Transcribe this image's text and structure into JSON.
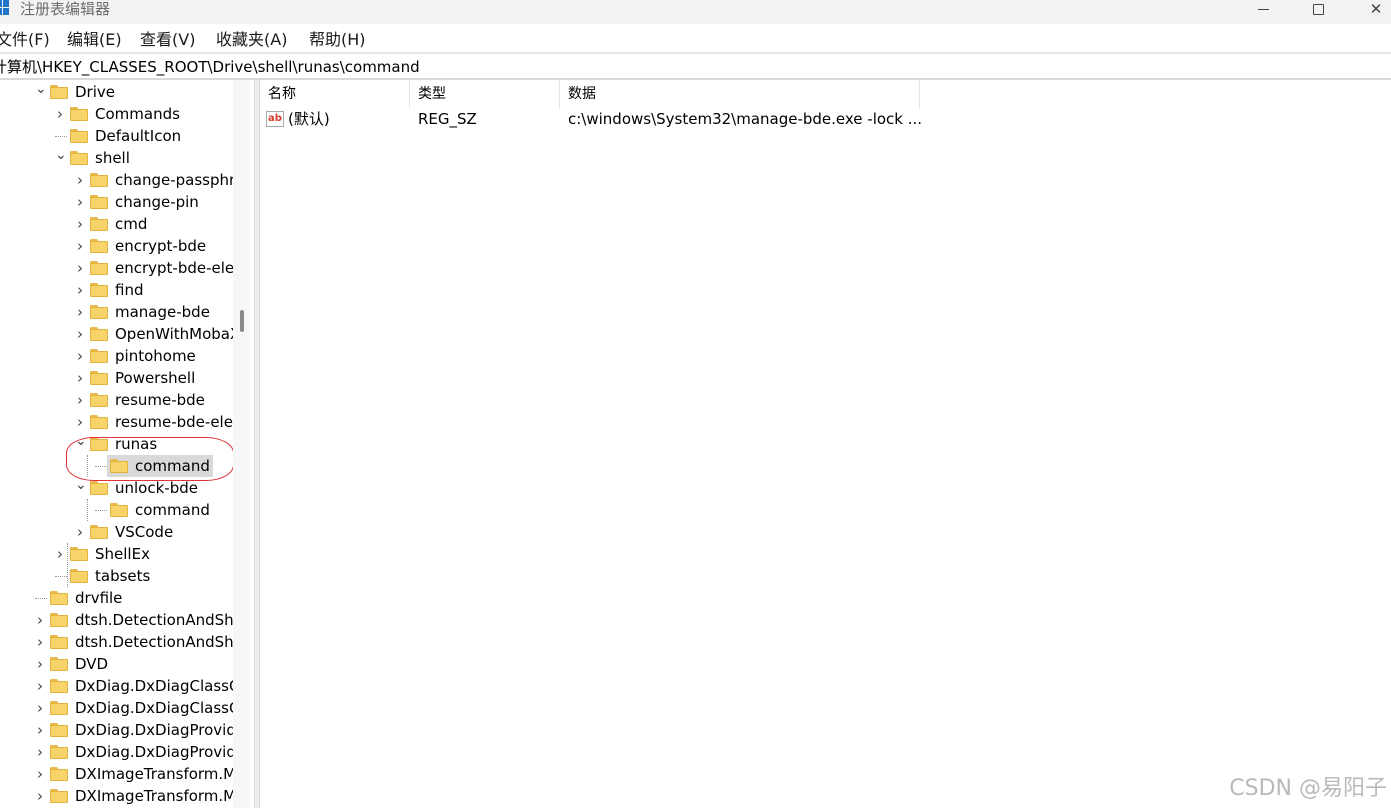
{
  "window": {
    "title": "注册表编辑器",
    "controls": [
      "minimize-icon",
      "maximize-icon",
      "close-icon"
    ]
  },
  "menu": [
    "文件(F)",
    "编辑(E)",
    "查看(V)",
    "收藏夹(A)",
    "帮助(H)"
  ],
  "address": "计算机\\HKEY_CLASSES_ROOT\\Drive\\shell\\runas\\command",
  "tree": {
    "items": [
      {
        "label": "Drive",
        "expand": "expanded"
      },
      {
        "label": "Commands",
        "expand": "collapsed"
      },
      {
        "label": "DefaultIcon",
        "expand": "none"
      },
      {
        "label": "shell",
        "expand": "expanded"
      },
      {
        "label": "change-passphrase",
        "expand": "collapsed"
      },
      {
        "label": "change-pin",
        "expand": "collapsed"
      },
      {
        "label": "cmd",
        "expand": "collapsed"
      },
      {
        "label": "encrypt-bde",
        "expand": "collapsed"
      },
      {
        "label": "encrypt-bde-elev",
        "expand": "collapsed"
      },
      {
        "label": "find",
        "expand": "collapsed"
      },
      {
        "label": "manage-bde",
        "expand": "collapsed"
      },
      {
        "label": "OpenWithMobaXterm",
        "expand": "collapsed"
      },
      {
        "label": "pintohome",
        "expand": "collapsed"
      },
      {
        "label": "Powershell",
        "expand": "collapsed"
      },
      {
        "label": "resume-bde",
        "expand": "collapsed"
      },
      {
        "label": "resume-bde-elev",
        "expand": "collapsed"
      },
      {
        "label": "runas",
        "expand": "expanded"
      },
      {
        "label": "command",
        "expand": "none",
        "selected": true
      },
      {
        "label": "unlock-bde",
        "expand": "expanded"
      },
      {
        "label": "command",
        "expand": "none"
      },
      {
        "label": "VSCode",
        "expand": "collapsed"
      },
      {
        "label": "ShellEx",
        "expand": "collapsed"
      },
      {
        "label": "tabsets",
        "expand": "none"
      },
      {
        "label": "drvfile",
        "expand": "none"
      },
      {
        "label": "dtsh.DetectionAndSharing",
        "expand": "collapsed"
      },
      {
        "label": "dtsh.DetectionAndSharing",
        "expand": "collapsed"
      },
      {
        "label": "DVD",
        "expand": "collapsed"
      },
      {
        "label": "DxDiag.DxDiagClassObject",
        "expand": "collapsed"
      },
      {
        "label": "DxDiag.DxDiagClassObject",
        "expand": "collapsed"
      },
      {
        "label": "DxDiag.DxDiagProvider",
        "expand": "collapsed"
      },
      {
        "label": "DxDiag.DxDiagProvider",
        "expand": "collapsed"
      },
      {
        "label": "DXImageTransform.M",
        "expand": "collapsed"
      },
      {
        "label": "DXImageTransform.M",
        "expand": "collapsed"
      }
    ]
  },
  "values_table": {
    "columns": [
      "名称",
      "类型",
      "数据"
    ],
    "rows": [
      {
        "icon": "string-value-icon",
        "icon_text": "ab",
        "name": "(默认)",
        "type": "REG_SZ",
        "data": "c:\\windows\\System32\\manage-bde.exe -lock ..."
      }
    ]
  },
  "watermark": "CSDN @易阳子",
  "colors": {
    "folder": "#f7d46a",
    "selection": "#d9d9d9",
    "annotation": "#e0303a"
  }
}
